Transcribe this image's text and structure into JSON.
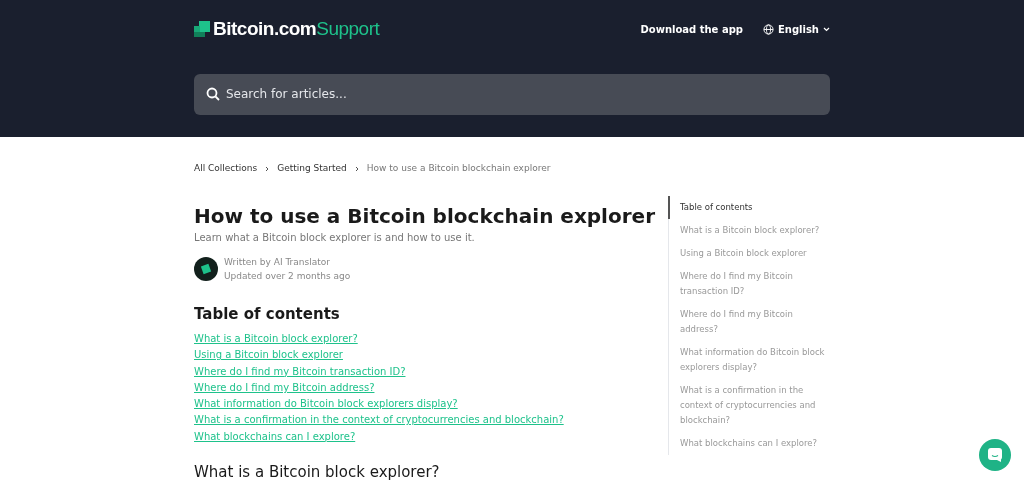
{
  "header": {
    "logo": {
      "brand": "Bitcoin.com",
      "suffix": "Support"
    },
    "download_link": "Download the app",
    "language": "English",
    "search": {
      "placeholder": "Search for articles..."
    }
  },
  "breadcrumb": [
    "All Collections",
    "Getting Started",
    "How to use a Bitcoin blockchain explorer"
  ],
  "article": {
    "title": "How to use a Bitcoin blockchain explorer",
    "subtitle": "Learn what a Bitcoin block explorer is and how to use it.",
    "author": "Written by AI Translator",
    "updated": "Updated over 2 months ago",
    "toc_heading": "Table of contents",
    "toc_links": [
      "What is a Bitcoin block explorer?",
      "Using a Bitcoin block explorer",
      "Where do I find my Bitcoin transaction ID?",
      "Where do I find my Bitcoin address?",
      "What information do Bitcoin block explorers display?",
      "What is a confirmation in the context of cryptocurrencies and blockchain?",
      "What blockchains can I explore?"
    ],
    "section_heading": "What is a Bitcoin block explorer?"
  },
  "side_toc": [
    {
      "label": "Table of contents",
      "selected": true
    },
    {
      "label": "What is a Bitcoin block explorer?",
      "selected": false
    },
    {
      "label": "Using a Bitcoin block explorer",
      "selected": false
    },
    {
      "label": "Where do I find my Bitcoin transaction ID?",
      "selected": false
    },
    {
      "label": "Where do I find my Bitcoin address?",
      "selected": false
    },
    {
      "label": "What information do Bitcoin block explorers display?",
      "selected": false
    },
    {
      "label": "What is a confirmation in the context of cryptocurrencies and blockchain?",
      "selected": false
    },
    {
      "label": "What blockchains can I explore?",
      "selected": false
    }
  ]
}
